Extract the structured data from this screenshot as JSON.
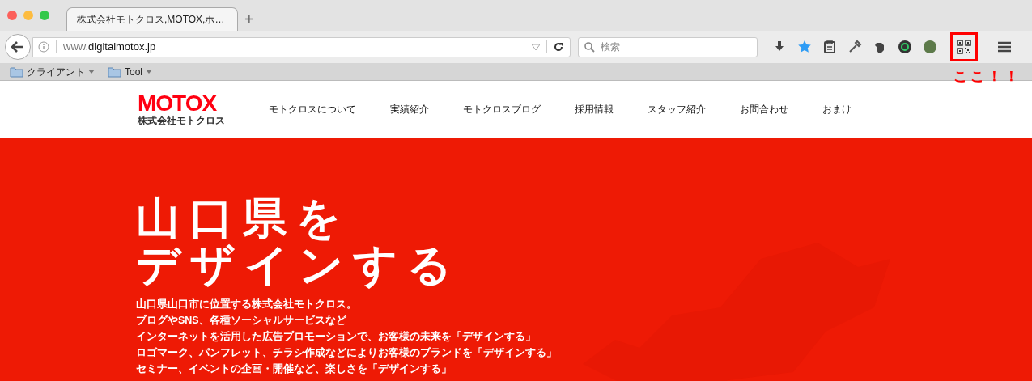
{
  "window": {
    "tab_title": "株式会社モトクロス,MOTOX,ホ…",
    "new_tab": "+"
  },
  "toolbar": {
    "url_prefix": "www.",
    "url_domain": "digitalmotox.jp",
    "search_placeholder": "検索"
  },
  "bookmarks": [
    {
      "label": "クライアント"
    },
    {
      "label": "Tool"
    }
  ],
  "annotation": "ここ！！",
  "site": {
    "logo": {
      "name": "MOTOX",
      "company": "株式会社モトクロス"
    },
    "nav": [
      "モトクロスについて",
      "実績紹介",
      "モトクロスブログ",
      "採用情報",
      "スタッフ紹介",
      "お問合わせ",
      "おまけ"
    ],
    "hero": {
      "title_lines": [
        "山口県を",
        "デザインする"
      ],
      "paragraph_lines": [
        "山口県山口市に位置する株式会社モトクロス。",
        "ブログやSNS、各種ソーシャルサービスなど",
        "インターネットを活用した広告プロモーションで、お客様の未来を「デザインする」",
        "ロゴマーク、パンフレット、チラシ作成などによりお客様のブランドを「デザインする」",
        "セミナー、イベントの企画・開催など、楽しさを「デザインする」"
      ]
    }
  }
}
